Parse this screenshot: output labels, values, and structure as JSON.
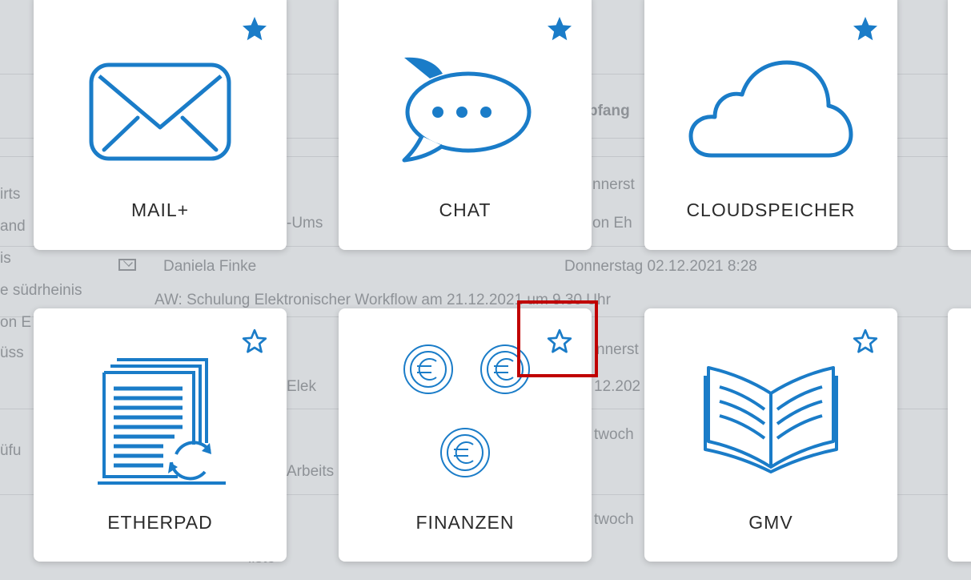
{
  "background": {
    "fragments": [
      {
        "id": "f1",
        "text": "irts"
      },
      {
        "id": "f2",
        "text": "and"
      },
      {
        "id": "f3",
        "text": "is"
      },
      {
        "id": "f4",
        "text": "e südrheinis"
      },
      {
        "id": "f5",
        "text": "on E"
      },
      {
        "id": "f6",
        "text": "üss"
      },
      {
        "id": "f7",
        "text": "üfu"
      },
      {
        "id": "f8",
        "text": "pfang"
      },
      {
        "id": "f9",
        "text": "nnerst"
      },
      {
        "id": "f10",
        "text": "-Ums"
      },
      {
        "id": "f11",
        "text": "on Eh"
      },
      {
        "id": "f12",
        "text": "Daniela Finke"
      },
      {
        "id": "f13",
        "text": "Donnerstag 02.12.2021 8:28"
      },
      {
        "id": "f14",
        "text": "AW: Schulung Elektronischer Workflow am 21.12.2021 um 9.30 Uhr"
      },
      {
        "id": "f15",
        "text": "nnerst"
      },
      {
        "id": "f16",
        "text": "Elek"
      },
      {
        "id": "f17",
        "text": "12.202"
      },
      {
        "id": "f18",
        "text": "twoch"
      },
      {
        "id": "f19",
        "text": "Arbeits"
      },
      {
        "id": "f20",
        "text": "twoch"
      },
      {
        "id": "f21",
        "text": "liste"
      }
    ]
  },
  "tiles": [
    {
      "id": "mail",
      "label": "MAIL+",
      "favorite": true,
      "icon": "mail-envelope-icon"
    },
    {
      "id": "chat",
      "label": "CHAT",
      "favorite": true,
      "icon": "chat-bubble-icon"
    },
    {
      "id": "cloud",
      "label": "CLOUDSPEICHER",
      "favorite": true,
      "icon": "cloud-icon"
    },
    {
      "id": "etherpad",
      "label": "ETHERPAD",
      "favorite": false,
      "icon": "document-sync-icon"
    },
    {
      "id": "finanzen",
      "label": "FINANZEN",
      "favorite": false,
      "icon": "euro-coins-icon"
    },
    {
      "id": "gmv",
      "label": "GMV",
      "favorite": false,
      "icon": "open-book-icon"
    }
  ],
  "colors": {
    "accent": "#1a7cc8",
    "highlight": "#c00000",
    "label": "#2b2b2b"
  }
}
